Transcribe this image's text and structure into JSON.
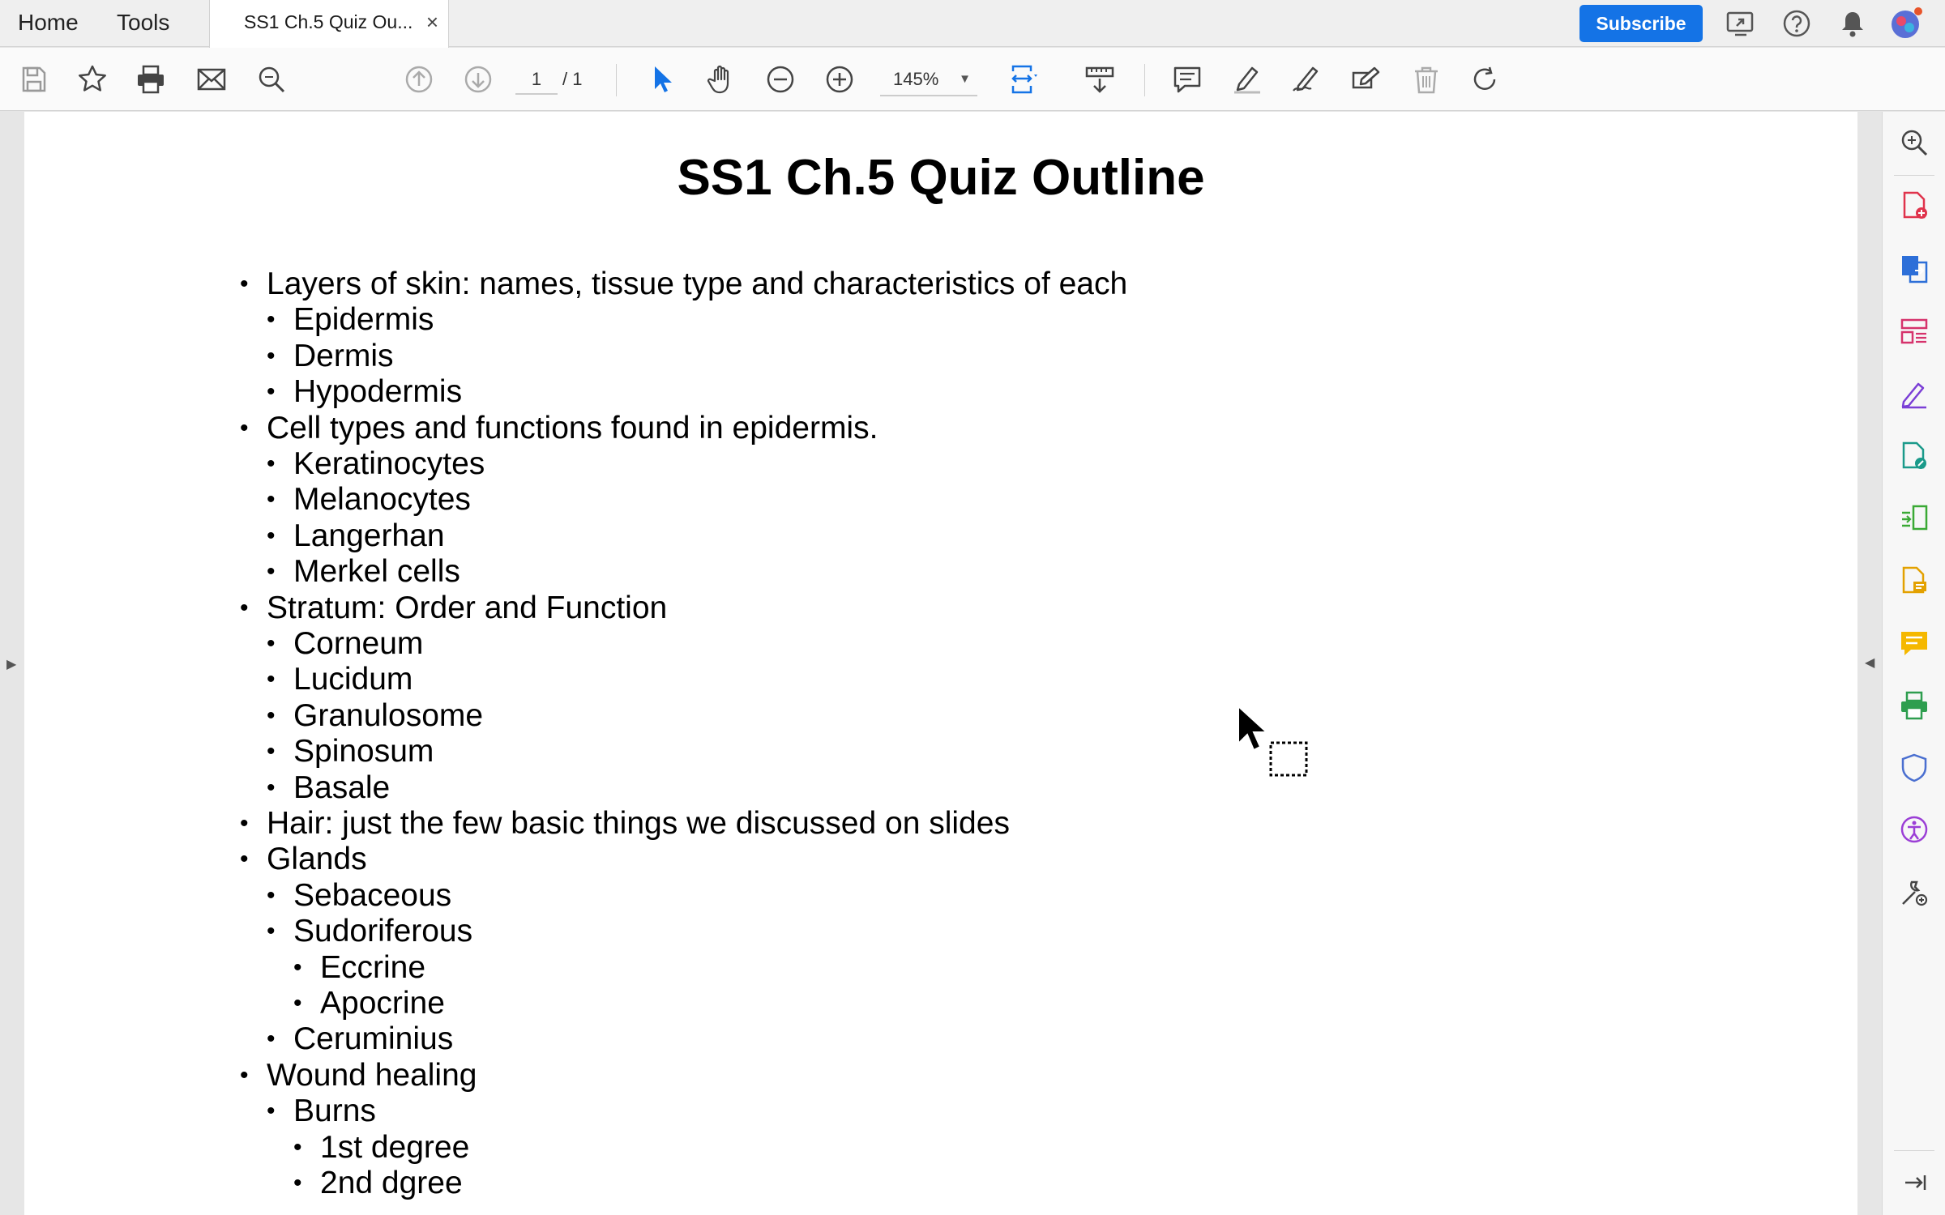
{
  "tabs": {
    "home_label": "Home",
    "tools_label": "Tools",
    "document_title": "SS1 Ch.5 Quiz Ou...",
    "close_glyph": "×"
  },
  "header": {
    "subscribe_label": "Subscribe",
    "accent_color": "#1473e6"
  },
  "toolbar": {
    "page_current": "1",
    "page_total": "/ 1",
    "zoom": "145%",
    "icons": [
      "save-icon",
      "bookmark-star-icon",
      "print-icon",
      "email-icon",
      "search-icon",
      "page-up-icon",
      "page-down-icon",
      "select-cursor-icon",
      "hand-tool-icon",
      "zoom-out-icon",
      "zoom-in-icon",
      "fit-page-icon",
      "scroll-mode-icon",
      "comment-icon",
      "highlight-icon",
      "sign-icon",
      "edit-text-icon",
      "delete-icon",
      "rotate-icon"
    ]
  },
  "document": {
    "title": "SS1 Ch.5 Quiz Outline",
    "outline": [
      {
        "level": 1,
        "text": "Layers of skin: names, tissue type and characteristics of each"
      },
      {
        "level": 2,
        "text": "Epidermis"
      },
      {
        "level": 2,
        "text": "Dermis"
      },
      {
        "level": 2,
        "text": "Hypodermis"
      },
      {
        "level": 1,
        "text": "Cell types and functions found in epidermis."
      },
      {
        "level": 2,
        "text": "Keratinocytes"
      },
      {
        "level": 2,
        "text": "Melanocytes"
      },
      {
        "level": 2,
        "text": "Langerhan"
      },
      {
        "level": 2,
        "text": "Merkel cells"
      },
      {
        "level": 1,
        "text": "Stratum: Order and Function"
      },
      {
        "level": 2,
        "text": "Corneum"
      },
      {
        "level": 2,
        "text": "Lucidum"
      },
      {
        "level": 2,
        "text": "Granulosome"
      },
      {
        "level": 2,
        "text": "Spinosum"
      },
      {
        "level": 2,
        "text": "Basale"
      },
      {
        "level": 1,
        "text": "Hair: just the few basic things we discussed on slides"
      },
      {
        "level": 1,
        "text": "Glands"
      },
      {
        "level": 2,
        "text": "Sebaceous"
      },
      {
        "level": 2,
        "text": "Sudoriferous"
      },
      {
        "level": 3,
        "text": "Eccrine"
      },
      {
        "level": 3,
        "text": "Apocrine"
      },
      {
        "level": 2,
        "text": "Ceruminius"
      },
      {
        "level": 1,
        "text": "Wound healing"
      },
      {
        "level": 2,
        "text": "Burns"
      },
      {
        "level": 3,
        "text": "1st degree"
      },
      {
        "level": 3,
        "text": "2nd dgree"
      }
    ]
  },
  "right_panel": {
    "icons": [
      "search-zoom-icon",
      "create-pdf-icon",
      "export-pdf-icon",
      "organize-pages-icon",
      "fill-sign-icon",
      "edit-pdf-icon",
      "combine-files-icon",
      "request-signature-icon",
      "comment-tool-icon",
      "scan-icon",
      "protect-icon",
      "accessibility-icon",
      "more-tools-icon",
      "collapse-panel-icon"
    ]
  }
}
